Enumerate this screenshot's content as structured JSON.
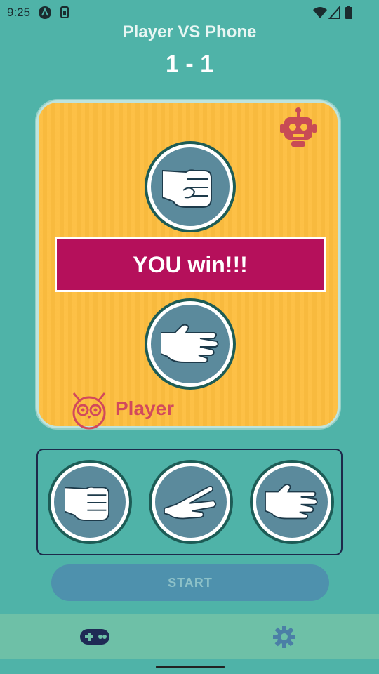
{
  "status_bar": {
    "time": "9:25",
    "icons": [
      "app-a-icon",
      "sim-icon",
      "wifi-icon",
      "signal-icon",
      "battery-icon"
    ]
  },
  "header": {
    "title": "Player VS Phone",
    "score": "1 - 1"
  },
  "arena": {
    "opponent_icon": "robot-icon",
    "opponent_hand": "rock",
    "result_text": "YOU win!!!",
    "player_hand": "paper",
    "player_icon": "owl-icon",
    "player_label": "Player"
  },
  "choices": [
    {
      "name": "rock",
      "icon": "rock-hand-icon"
    },
    {
      "name": "scissors",
      "icon": "scissors-hand-icon"
    },
    {
      "name": "paper",
      "icon": "paper-hand-icon"
    }
  ],
  "start_button": {
    "label": "START"
  },
  "bottom_nav": {
    "items": [
      {
        "icon": "gamepad-icon"
      },
      {
        "icon": "settings-gear-icon"
      }
    ]
  },
  "colors": {
    "background": "#4fb3a8",
    "arena": "#fdbe3f",
    "banner": "#b5105b",
    "accent": "#d2495c"
  }
}
